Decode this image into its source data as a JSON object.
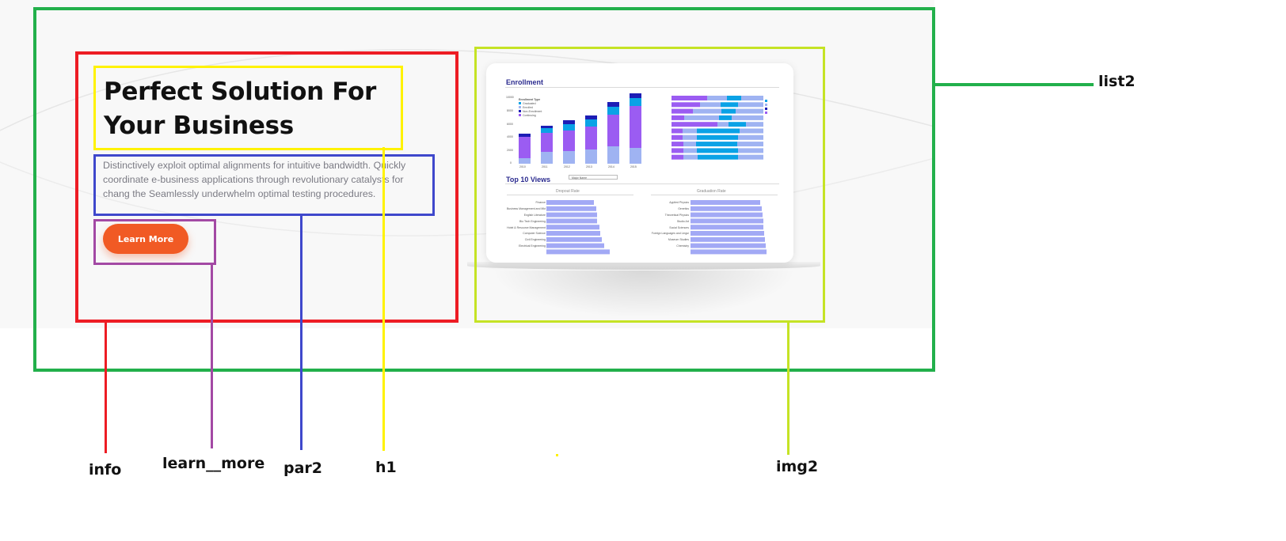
{
  "hero": {
    "title_line1": "Perfect Solution For",
    "title_line2": "Your Business",
    "description_line1": "Distinctively exploit optimal alignments for intuitive bandwidth. Quickly",
    "description_line2": "coordinate e-business applications through revolutionary catalysts for",
    "description_line3": "chang the Seamlessly underwhelm optimal testing procedures.",
    "cta_label": "Learn More"
  },
  "dashboard": {
    "enrollment_title": "Enrollment",
    "legend_title": "Enrollment Type",
    "legend_items": [
      "Graduated",
      "Enrolled",
      "Non-Enrollment",
      "Continuing"
    ],
    "y_ticks": [
      "10000",
      "8000",
      "6000",
      "4000",
      "2000",
      "0"
    ],
    "years": [
      "2010",
      "2011",
      "2012",
      "2013",
      "2014",
      "2015"
    ],
    "top_views_title": "Top 10 Views",
    "select_value": "Major Name",
    "dropout_title": "Dropout Rate",
    "graduation_title": "Graduation Rate",
    "dropout_labels": [
      "Finance",
      "Business Management and Mkt",
      "English Literature",
      "Bio Tech Engineering",
      "Hotel & Resource Management",
      "Computer Science",
      "Civil Engineering",
      "Electrical Engineering"
    ],
    "graduation_labels": [
      "Applied Physics",
      "Genetics",
      "Theoretical Physics",
      "Studio Art",
      "Social Sciences",
      "Foreign Languages and Lingui",
      "Museum Studies",
      "Chemistry"
    ],
    "colors": {
      "purple": "#9b5cf2",
      "lightblue": "#9fb3f2",
      "blue": "#0aa2e6",
      "navy": "#1d1db5",
      "bar": "#a2a9f5"
    }
  },
  "annotations": {
    "list2": "list2",
    "info": "info",
    "learn_more": "learn__more",
    "par2": "par2",
    "h1": "h1",
    "img2": "img2"
  }
}
